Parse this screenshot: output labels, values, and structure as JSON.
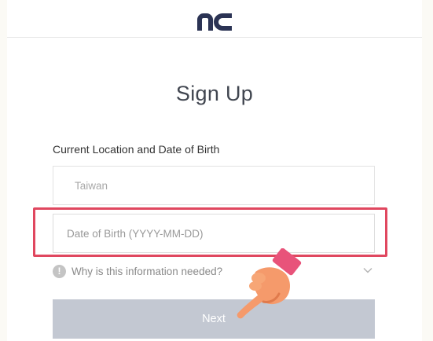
{
  "header": {
    "logo_icon": "nc-logo"
  },
  "main": {
    "title": "Sign Up",
    "section_label": "Current Location and Date of Birth",
    "country_value": "Taiwan",
    "dob_placeholder": "Date of Birth (YYYY-MM-DD)",
    "info_text": "Why is this information needed?",
    "next_label": "Next"
  },
  "colors": {
    "brand": "#2b3354",
    "highlight": "#e0475f",
    "button_disabled": "#c3c8d2"
  },
  "icons": {
    "info": "info-icon",
    "chevron": "chevron-down-icon",
    "pointer": "hand-pointer-icon"
  }
}
